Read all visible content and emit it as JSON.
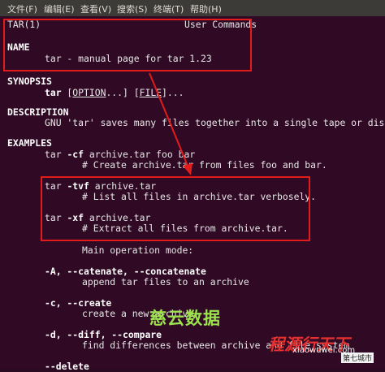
{
  "menu": [
    "文件(F)",
    "编辑(E)",
    "查看(V)",
    "搜索(S)",
    "终端(T)",
    "帮助(H)"
  ],
  "header": {
    "left": "TAR(1)",
    "right": "User Commands"
  },
  "name": {
    "heading": "NAME",
    "text": "tar - manual page for tar 1.23"
  },
  "synopsis": {
    "heading": "SYNOPSIS",
    "cmd": "tar",
    "option": "OPTION",
    "option_suffix": "...]",
    "file": "FILE",
    "file_suffix": "]..."
  },
  "description": {
    "heading": "DESCRIPTION",
    "text": "GNU 'tar' saves many files together into a single tape or disk"
  },
  "examples": {
    "heading": "EXAMPLES",
    "items": [
      {
        "cmd": "tar",
        "flag": "-cf",
        "arg": "archive.tar foo bar",
        "comment": "# Create archive.tar from files foo and bar."
      },
      {
        "cmd": "tar",
        "flag": "-tvf",
        "arg": "archive.tar",
        "comment": "# List all files in archive.tar verbosely."
      },
      {
        "cmd": "tar",
        "flag": "-xf",
        "arg": "archive.tar",
        "comment": "# Extract all files from archive.tar."
      }
    ]
  },
  "main_mode": "Main operation mode:",
  "options": [
    {
      "flag": "-A, --catenate, --concatenate",
      "desc": "append tar files to an archive"
    },
    {
      "flag": "-c, --create",
      "desc": "create a new archive"
    },
    {
      "flag": "-d, --diff, --compare",
      "desc": "find differences between archive and file system"
    },
    {
      "flag": "--delete",
      "desc": ""
    }
  ],
  "watermarks": {
    "green": "慈云数据",
    "red": "程源行天下",
    "url": "xiaowuwei.com",
    "stamp": "第七城市"
  },
  "colors": {
    "terminal_bg": "#300a24",
    "menubar_bg": "#3c3b37",
    "annotation": "#e21b1b",
    "text": "#e6e6e6"
  }
}
